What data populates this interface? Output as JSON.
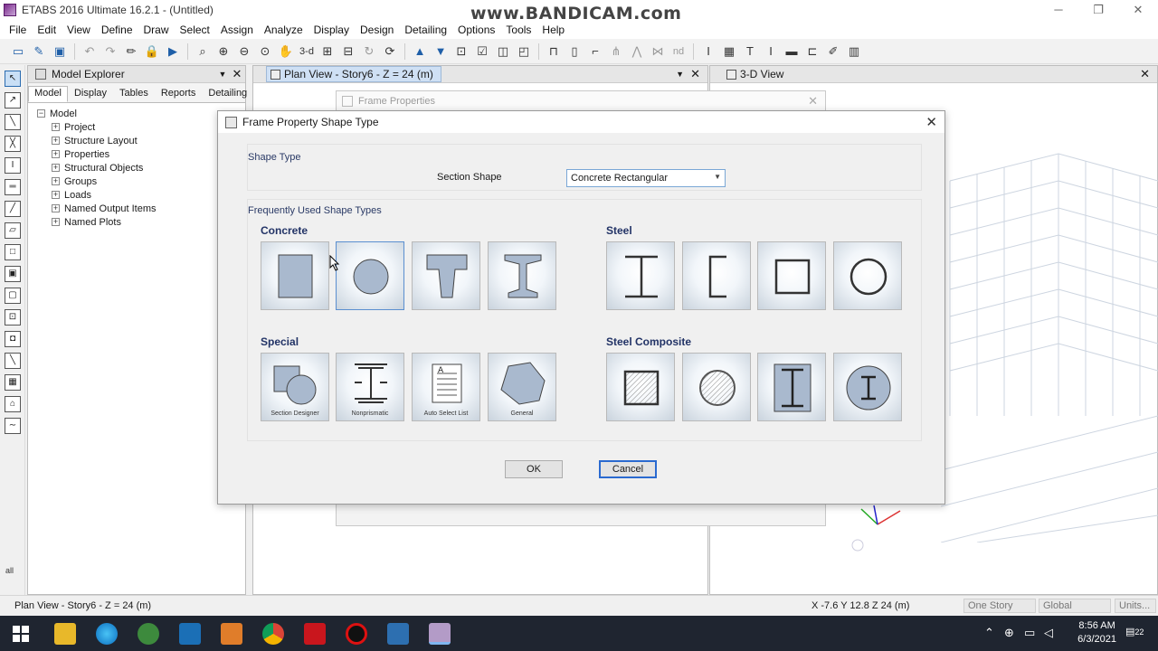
{
  "window": {
    "title": "ETABS 2016 Ultimate 16.2.1 - (Untitled)",
    "watermark": "www.BANDICAM.com",
    "controls": [
      "minimize-icon",
      "restore-icon",
      "close-icon"
    ]
  },
  "menu": [
    "File",
    "Edit",
    "View",
    "Define",
    "Draw",
    "Select",
    "Assign",
    "Analyze",
    "Display",
    "Design",
    "Detailing",
    "Options",
    "Tools",
    "Help"
  ],
  "toolbar": {
    "buttons": [
      "new-model-icon",
      "open-icon",
      "save-icon",
      "undo-icon",
      "redo-icon",
      "pencil-icon",
      "lock-icon",
      "run-icon",
      "zoom-window-icon",
      "zoom-in-icon",
      "zoom-out-icon",
      "zoom-fit-icon",
      "pan-icon",
      "3d-label",
      "plan-label",
      "elevation-label",
      "rotate-icon",
      "perspective-icon",
      "move-up-icon",
      "move-down-icon",
      "select-icon",
      "check-icon",
      "object-shrink-icon",
      "display-icon",
      "frame-icon",
      "wall-icon",
      "brace-icon",
      "nd-label",
      "column-icon",
      "wall-type-icon",
      "beam-icon",
      "slab-icon",
      "opening-icon",
      "link-icon",
      "load-icon",
      "design-icon"
    ],
    "text_3d": "3-d",
    "text_nd": "nd"
  },
  "explorer": {
    "title": "Model Explorer",
    "tabs": [
      "Model",
      "Display",
      "Tables",
      "Reports",
      "Detailing"
    ],
    "active_tab": "Model",
    "root": "Model",
    "children": [
      "Project",
      "Structure Layout",
      "Properties",
      "Structural Objects",
      "Groups",
      "Loads",
      "Named Output Items",
      "Named Plots"
    ]
  },
  "plan_pane": {
    "tab_label": "Plan View - Story6 - Z = 24 (m)"
  },
  "view_pane": {
    "tab_label": "3-D View"
  },
  "behind_dialog": {
    "title": "Frame Properties"
  },
  "dialog": {
    "title": "Frame Property Shape Type",
    "group1_label": "Shape Type",
    "section_shape_label": "Section Shape",
    "section_shape_value": "Concrete Rectangular",
    "group2_label": "Frequently Used Shape Types",
    "concrete_label": "Concrete",
    "steel_label": "Steel",
    "special_label": "Special",
    "steel_composite_label": "Steel Composite",
    "special_captions": [
      "Section Designer",
      "Nonprismatic",
      "Auto Select List",
      "General"
    ],
    "ok": "OK",
    "cancel": "Cancel",
    "selected_shape": "concrete-circle"
  },
  "status": {
    "left": "Plan View - Story6 - Z = 24 (m)",
    "coords": "X -7.6  Y 12.8  Z 24 (m)",
    "story": "One Story",
    "coord_sys": "Global",
    "units": "Units..."
  },
  "taskbar": {
    "time": "8:56 AM",
    "date": "6/3/2021",
    "notifications": "22",
    "apps": [
      "windows-start-icon",
      "file-explorer-icon",
      "edge-icon",
      "qgis-icon",
      "autocad-icon",
      "media-icon",
      "chrome-icon",
      "acrobat-icon",
      "bandicam-record-icon",
      "photos-icon",
      "etabs-icon"
    ]
  },
  "colors": {
    "accent": "#2a6ad0",
    "shape_fill": "#a9b9ce",
    "taskbar": "#1f2530"
  }
}
